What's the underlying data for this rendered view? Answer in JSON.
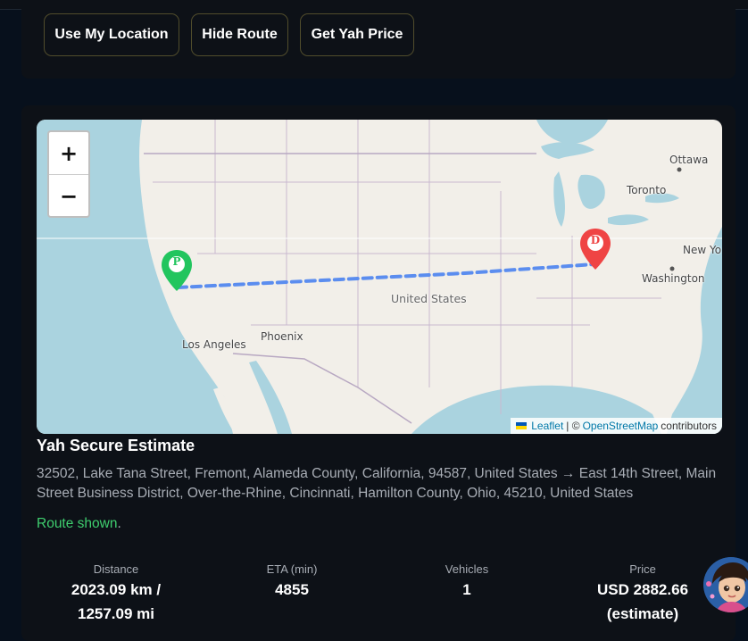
{
  "toolbar": {
    "use_location": "Use My Location",
    "hide_route": "Hide Route",
    "get_price": "Get Yah Price"
  },
  "map": {
    "zoom_in": "+",
    "zoom_out": "−",
    "labels": {
      "ottawa": "Ottawa",
      "toronto": "Toronto",
      "new_york": "New Yo",
      "washington": "Washington",
      "united_states": "United States",
      "phoenix": "Phoenix",
      "los_angeles": "Los Angeles"
    },
    "pickup_marker": "P",
    "dropoff_marker": "D",
    "attribution": {
      "leaflet": "Leaflet",
      "separator": "| ©",
      "osm": "OpenStreetMap",
      "contributors": "contributors"
    },
    "colors": {
      "route": "#5b8def",
      "pickup": "#22c55e",
      "dropoff": "#ef4444"
    }
  },
  "estimate": {
    "title": "Yah Secure Estimate",
    "route_text": "32502, Lake Tana Street, Fremont, Alameda County, California, 94587, United States → East 14th Street, Main Street Business District, Over-the-Rhine, Cincinnati, Hamilton County, Ohio, 45210, United States",
    "status": "Route shown",
    "status_suffix": "."
  },
  "stats": {
    "distance": {
      "label": "Distance",
      "line1": "2023.09 km /",
      "line2": "1257.09 mi"
    },
    "eta": {
      "label": "ETA (min)",
      "value": "4855"
    },
    "vehicles": {
      "label": "Vehicles",
      "value": "1"
    },
    "price": {
      "label": "Price",
      "line1": "USD 2882.66",
      "line2": "(estimate)"
    }
  },
  "colors": {
    "background": "#07101c",
    "panel": "#0d1117",
    "button_border": "#514d2c",
    "status_green": "#3fcf6f"
  }
}
